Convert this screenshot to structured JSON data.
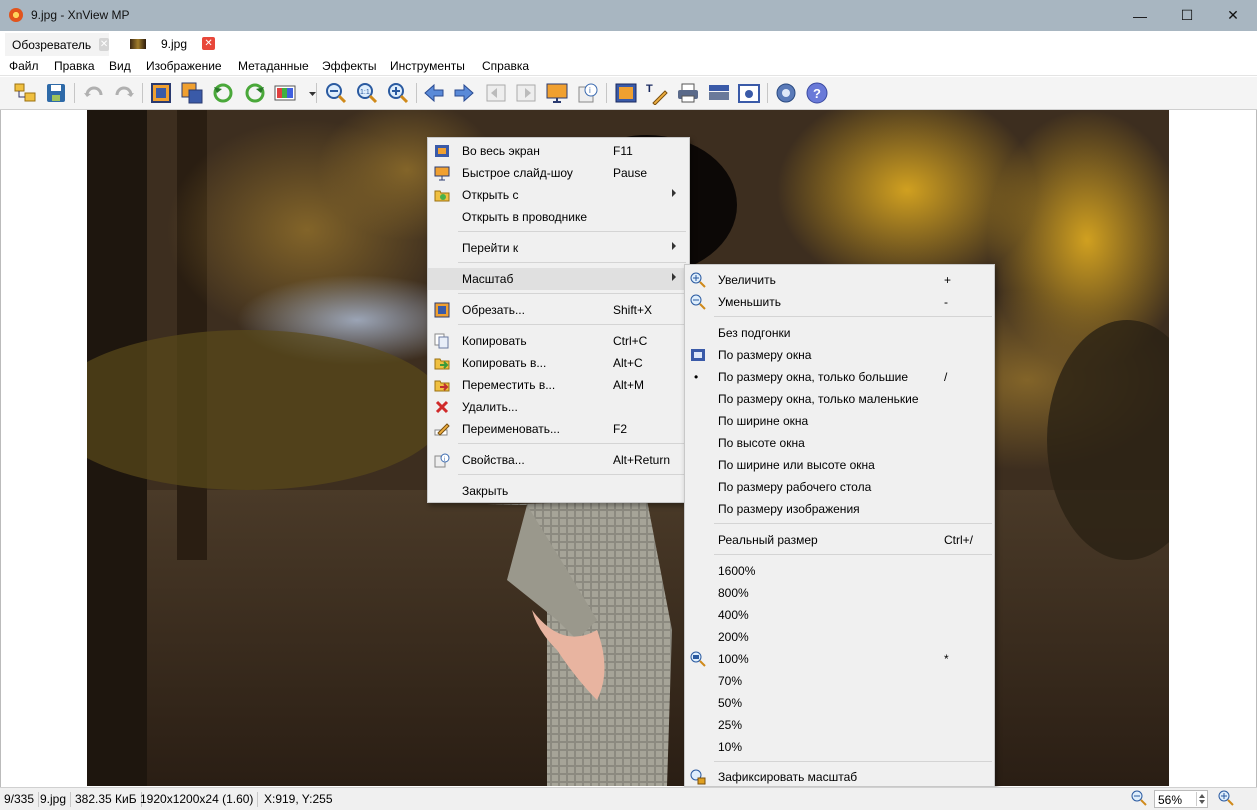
{
  "window": {
    "title": "9.jpg - XnView MP",
    "minimize_glyph": "—",
    "maximize_glyph": "☐",
    "close_glyph": "✕"
  },
  "tabs": [
    {
      "label": "Обозреватель",
      "close": "✕"
    },
    {
      "label": "9.jpg",
      "close": "✕"
    }
  ],
  "menu": [
    "Файл",
    "Правка",
    "Вид",
    "Изображение",
    "Метаданные",
    "Эффекты",
    "Инструменты",
    "Справка"
  ],
  "toolbar_icons": [
    "browser-icon",
    "save-icon",
    "undo-icon",
    "redo-icon",
    "crop-icon",
    "resize-icon",
    "rotate-left-icon",
    "rotate-right-icon",
    "adjust-colors-icon",
    "zoom-out-icon",
    "zoom-fit-icon",
    "zoom-in-icon",
    "previous-icon",
    "next-icon",
    "first-icon",
    "last-icon",
    "slideshow-icon",
    "info-icon",
    "fullscreen-icon",
    "edit-text-icon",
    "print-icon",
    "scanner-icon",
    "capture-icon",
    "settings-icon",
    "help-icon"
  ],
  "context_menu": {
    "items": [
      {
        "label": "Во весь экран",
        "shortcut": "F11",
        "icon": "fullscreen-icon"
      },
      {
        "label": "Быстрое слайд-шоу",
        "shortcut": "Pause",
        "icon": "slideshow-icon"
      },
      {
        "label": "Открыть с",
        "shortcut": "",
        "icon": "open-with-icon",
        "submenu": true
      },
      {
        "label": "Открыть в проводнике",
        "shortcut": "",
        "icon": ""
      },
      {
        "label": "Перейти к",
        "shortcut": "",
        "icon": "",
        "submenu": true
      },
      {
        "label": "Масштаб",
        "shortcut": "",
        "icon": "",
        "submenu": true,
        "active": true
      },
      {
        "label": "Обрезать...",
        "shortcut": "Shift+X",
        "icon": "crop-icon"
      },
      {
        "label": "Копировать",
        "shortcut": "Ctrl+C",
        "icon": "copy-icon"
      },
      {
        "label": "Копировать в...",
        "shortcut": "Alt+C",
        "icon": "copy-to-icon"
      },
      {
        "label": "Переместить в...",
        "shortcut": "Alt+M",
        "icon": "move-to-icon"
      },
      {
        "label": "Удалить...",
        "shortcut": "",
        "icon": "delete-icon"
      },
      {
        "label": "Переименовать...",
        "shortcut": "F2",
        "icon": "rename-icon"
      },
      {
        "label": "Свойства...",
        "shortcut": "Alt+Return",
        "icon": "properties-icon"
      },
      {
        "label": "Закрыть",
        "shortcut": "",
        "icon": ""
      }
    ]
  },
  "zoom_submenu": {
    "items": [
      {
        "label": "Увеличить",
        "shortcut": "+",
        "icon": "zoom-in-icon"
      },
      {
        "label": "Уменьшить",
        "shortcut": "-",
        "icon": "zoom-out-icon"
      },
      {
        "label": "Без подгонки",
        "shortcut": "",
        "icon": ""
      },
      {
        "label": "По размеру окна",
        "shortcut": "",
        "icon": "fit-window-icon"
      },
      {
        "label": "По размеру окна, только большие",
        "shortcut": "/",
        "icon": "",
        "bullet": "•"
      },
      {
        "label": "По размеру окна, только маленькие",
        "shortcut": "",
        "icon": ""
      },
      {
        "label": "По ширине окна",
        "shortcut": "",
        "icon": ""
      },
      {
        "label": "По высоте окна",
        "shortcut": "",
        "icon": ""
      },
      {
        "label": "По ширине или высоте окна",
        "shortcut": "",
        "icon": ""
      },
      {
        "label": "По размеру рабочего стола",
        "shortcut": "",
        "icon": ""
      },
      {
        "label": "По размеру изображения",
        "shortcut": "",
        "icon": ""
      },
      {
        "label": "Реальный размер",
        "shortcut": "Ctrl+/",
        "icon": ""
      },
      {
        "label": "1600%",
        "shortcut": "",
        "icon": ""
      },
      {
        "label": "800%",
        "shortcut": "",
        "icon": ""
      },
      {
        "label": "400%",
        "shortcut": "",
        "icon": ""
      },
      {
        "label": "200%",
        "shortcut": "",
        "icon": ""
      },
      {
        "label": "100%",
        "shortcut": "*",
        "icon": "actual-size-icon"
      },
      {
        "label": "70%",
        "shortcut": "",
        "icon": ""
      },
      {
        "label": "50%",
        "shortcut": "",
        "icon": ""
      },
      {
        "label": "25%",
        "shortcut": "",
        "icon": ""
      },
      {
        "label": "10%",
        "shortcut": "",
        "icon": ""
      },
      {
        "label": "Зафиксировать масштаб",
        "shortcut": "",
        "icon": "lock-zoom-icon"
      }
    ]
  },
  "status": {
    "position": "9/335",
    "filename": "9.jpg",
    "filesize": "382.35 КиБ",
    "dimensions": "1920x1200x24 (1.60)",
    "cursor": "X:919, Y:255",
    "zoom": "56%"
  }
}
